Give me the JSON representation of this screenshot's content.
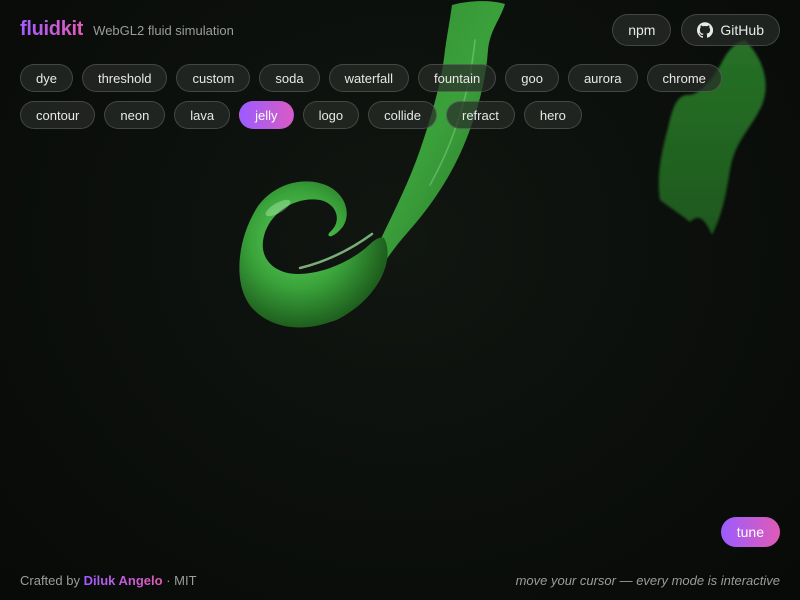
{
  "brand": {
    "logo": "fluidkit",
    "tagline": "WebGL2 fluid simulation"
  },
  "links": {
    "npm": "npm",
    "github": "GitHub",
    "github_icon": "github-icon"
  },
  "modes": [
    {
      "label": "dye",
      "active": false
    },
    {
      "label": "threshold",
      "active": false
    },
    {
      "label": "custom",
      "active": false
    },
    {
      "label": "soda",
      "active": false
    },
    {
      "label": "waterfall",
      "active": false
    },
    {
      "label": "fountain",
      "active": false
    },
    {
      "label": "goo",
      "active": false
    },
    {
      "label": "aurora",
      "active": false
    },
    {
      "label": "chrome",
      "active": false
    },
    {
      "label": "contour",
      "active": false
    },
    {
      "label": "neon",
      "active": false
    },
    {
      "label": "lava",
      "active": false
    },
    {
      "label": "jelly",
      "active": true
    },
    {
      "label": "logo",
      "active": false
    },
    {
      "label": "collide",
      "active": false
    },
    {
      "label": "refract",
      "active": false
    },
    {
      "label": "hero",
      "active": false
    }
  ],
  "tune": {
    "label": "tune"
  },
  "footer": {
    "crafted_by": "Crafted by",
    "author": "Diluk Angelo",
    "separator": "·",
    "license": "MIT",
    "hint": "move your cursor — every mode is interactive"
  },
  "colors": {
    "background": "#0b0e0b",
    "accent_start": "#9b5cff",
    "accent_end": "#e05bb6",
    "fluid": "#2f8f2f",
    "fluid_highlight": "#7fe07f"
  }
}
